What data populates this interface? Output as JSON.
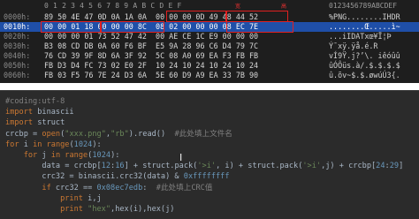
{
  "hex": {
    "header_cols": "0  1  2  3  4  5  6  7  8  9  A  B  C  D  E  F",
    "ascii_header": "0123456789ABCDEF",
    "annotations": [
      "宽",
      "高"
    ],
    "rows": [
      {
        "addr": "0000h:",
        "bytes": "89 50 4E 47 0D 0A 1A 0A  00 00 00 0D 49 48 44 52",
        "ascii": "%PNG........IHDR"
      },
      {
        "addr": "0010h:",
        "bytes": "00 00 01 18 00 00 00 8C  08 02 00 00 00 08 EC 7E",
        "ascii": "........Œ.....ì~",
        "selected": true
      },
      {
        "addr": "0020h:",
        "bytes": "00 00 00 01 73 52 47 42  00 AE CE 1C E9 00 00 00",
        "ascii": "...iIDATxœ¥Ï¦Þ"
      },
      {
        "addr": "0030h:",
        "bytes": "B3 08 CD DB 0A 60 F6 BF  E5 9A 28 96 C6 D4 79 7C",
        "ascii": "Ý¯xÿ.ÿå.é.R"
      },
      {
        "addr": "0040h:",
        "bytes": "76 CD 39 9F 8D 6A 3F 92  5C 08 A0 69 EA F3 FB FB",
        "ascii": "vÍ9Ÿ.j?’\\. iêóûû"
      },
      {
        "addr": "0050h:",
        "bytes": "FB D3 D4 FC 73 02 E0 2F  10 24 10 24 10 24 10 24",
        "ascii": "ûÓÔüs.à/.$.$.$.$"
      },
      {
        "addr": "0060h:",
        "bytes": "FB 03 F5 76 7E 24 D3 6A  5E 60 D9 A9 EA 33 7B 90",
        "ascii": "û.õv~$.$.øwúÚ3{."
      }
    ]
  },
  "code": {
    "lines": [
      [
        {
          "t": "#coding:utf-8",
          "c": "cm"
        }
      ],
      [
        {
          "t": "import ",
          "c": "kw"
        },
        {
          "t": "binascii",
          "c": "fn"
        }
      ],
      [
        {
          "t": "import ",
          "c": "kw"
        },
        {
          "t": "struct",
          "c": "fn"
        }
      ],
      [
        {
          "t": "crcbp = ",
          "c": "fn"
        },
        {
          "t": "open",
          "c": "kw"
        },
        {
          "t": "(",
          "c": "fn"
        },
        {
          "t": "\"xxx.png\"",
          "c": "str"
        },
        {
          "t": ",",
          "c": "fn"
        },
        {
          "t": "\"rb\"",
          "c": "str"
        },
        {
          "t": ").read()  ",
          "c": "fn"
        },
        {
          "t": "#此处填上文件名",
          "c": "cm"
        }
      ],
      [
        {
          "t": "for ",
          "c": "kw"
        },
        {
          "t": "i ",
          "c": "fn"
        },
        {
          "t": "in ",
          "c": "kw"
        },
        {
          "t": "range",
          "c": "kw"
        },
        {
          "t": "(",
          "c": "fn"
        },
        {
          "t": "1024",
          "c": "num"
        },
        {
          "t": "):",
          "c": "fn"
        }
      ],
      [
        {
          "t": "    for ",
          "c": "kw"
        },
        {
          "t": "j ",
          "c": "fn"
        },
        {
          "t": "in ",
          "c": "kw"
        },
        {
          "t": "range",
          "c": "kw"
        },
        {
          "t": "(",
          "c": "fn"
        },
        {
          "t": "1024",
          "c": "num"
        },
        {
          "t": "):",
          "c": "fn"
        }
      ],
      [
        {
          "t": "        data = crcbp[",
          "c": "fn"
        },
        {
          "t": "12",
          "c": "num"
        },
        {
          "t": ":",
          "c": "fn"
        },
        {
          "t": "16",
          "c": "num"
        },
        {
          "t": "] + struct.pack(",
          "c": "fn"
        },
        {
          "t": "'>i'",
          "c": "str"
        },
        {
          "t": ", i) + struct.pack(",
          "c": "fn"
        },
        {
          "t": "'>i'",
          "c": "str"
        },
        {
          "t": ",j) + crcbp[",
          "c": "fn"
        },
        {
          "t": "24",
          "c": "num"
        },
        {
          "t": ":",
          "c": "fn"
        },
        {
          "t": "29",
          "c": "num"
        },
        {
          "t": "]",
          "c": "fn"
        }
      ],
      [
        {
          "t": "        crc32 = binascii.crc32(data) & ",
          "c": "fn"
        },
        {
          "t": "0xffffffff",
          "c": "num"
        }
      ],
      [
        {
          "t": "        if ",
          "c": "kw"
        },
        {
          "t": "crc32 == ",
          "c": "fn"
        },
        {
          "t": "0x08ec7edb",
          "c": "num"
        },
        {
          "t": ":  ",
          "c": "fn"
        },
        {
          "t": "#此处填上CRC值",
          "c": "cm"
        }
      ],
      [
        {
          "t": "            print ",
          "c": "kw"
        },
        {
          "t": "i,j",
          "c": "fn"
        }
      ],
      [
        {
          "t": "            print ",
          "c": "kw"
        },
        {
          "t": "\"hex\"",
          "c": "str"
        },
        {
          "t": ",hex(i),hex(j)",
          "c": "fn"
        }
      ]
    ]
  }
}
